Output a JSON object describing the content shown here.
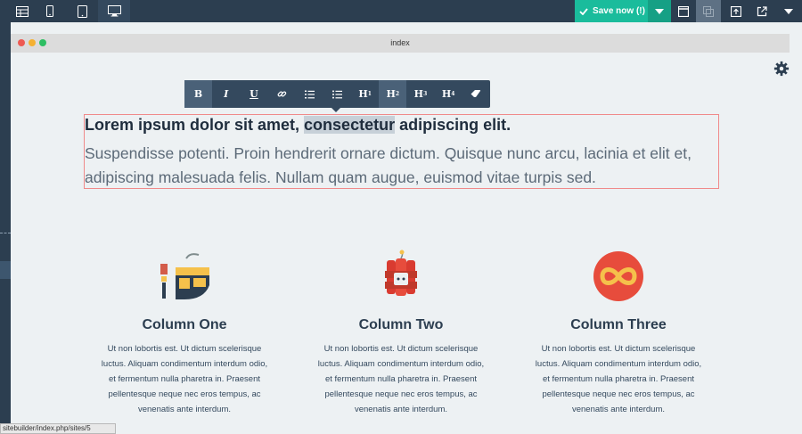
{
  "toolbar": {
    "save_label": "Save now (!)",
    "icons": [
      "layout-icon",
      "mobile-icon",
      "tablet-icon",
      "desktop-icon",
      "preview-icon",
      "duplicate-icon",
      "export-icon",
      "external-link-icon",
      "chevron-down-icon"
    ]
  },
  "browser": {
    "title": "index",
    "dots": [
      "#ee5a52",
      "#f5b133",
      "#2dbe62"
    ]
  },
  "editor_toolbar": {
    "buttons": [
      "B",
      "I",
      "U",
      "link",
      "ordered-list",
      "unordered-list",
      "H1",
      "H2",
      "H3",
      "H4",
      "eraser"
    ]
  },
  "content": {
    "headline_pre": "Lorem ipsum dolor sit amet, ",
    "headline_selected": "consectetur",
    "headline_post": " adipiscing elit.",
    "body": "Suspendisse potenti. Proin hendrerit ornare dictum. Quisque nunc arcu, lacinia et elit et, adipiscing malesuada felis. Nullam quam augue, euismod vitae turpis sed."
  },
  "columns": [
    {
      "title": "Column One",
      "icon": "paint-brush-icon",
      "text": "Ut non lobortis est. Ut dictum scelerisque luctus. Aliquam condimentum interdum odio, et fermentum nulla pharetra in. Praesent pellentesque neque nec eros tempus, ac venenatis ante interdum."
    },
    {
      "title": "Column Two",
      "icon": "dynamite-icon",
      "text": "Ut non lobortis est. Ut dictum scelerisque luctus. Aliquam condimentum interdum odio, et fermentum nulla pharetra in. Praesent pellentesque neque nec eros tempus, ac venenatis ante interdum."
    },
    {
      "title": "Column Three",
      "icon": "infinity-icon",
      "text": "Ut non lobortis est. Ut dictum scelerisque luctus. Aliquam condimentum interdum odio, et fermentum nulla pharetra in. Praesent pellentesque neque nec eros tempus, ac venenatis ante interdum."
    }
  ],
  "status": {
    "url": "sitebuilder/index.php/sites/5"
  },
  "colors": {
    "toolbar_bg": "#2c3e50",
    "save_green": "#1abc9c",
    "editor_bg": "#34495e",
    "canvas_bg": "#edf1f3",
    "selection_border": "#f08a8a"
  }
}
